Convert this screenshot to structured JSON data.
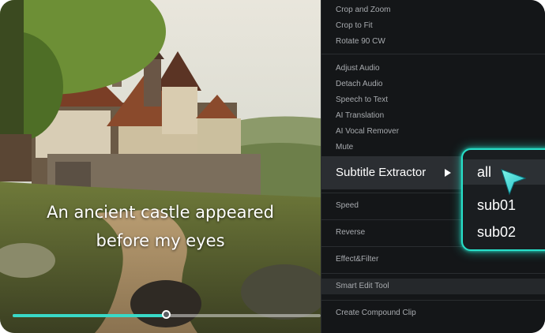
{
  "video": {
    "subtitle_lines": [
      "An ancient castle appeared",
      "before my eyes"
    ],
    "progress": 0.5
  },
  "menu": {
    "items": [
      "Crop and Zoom",
      "Crop to Fit",
      "Rotate 90 CW",
      "Adjust Audio",
      "Detach Audio",
      "Speech to Text",
      "AI Translation",
      "AI Vocal Remover",
      "Mute",
      "Subtitle Extractor",
      "Speed",
      "Reverse",
      "Effect&Filter",
      "Smart Edit Tool",
      "Create Compound Clip"
    ],
    "highlighted": "Subtitle Extractor"
  },
  "submenu": {
    "items": [
      "all",
      "sub01",
      "sub02"
    ],
    "selected": "all",
    "accent_color": "#27e0c9"
  },
  "colors": {
    "progress_accent": "#39d9c7",
    "menu_bg": "#141618",
    "menu_text": "#a8abaf"
  }
}
